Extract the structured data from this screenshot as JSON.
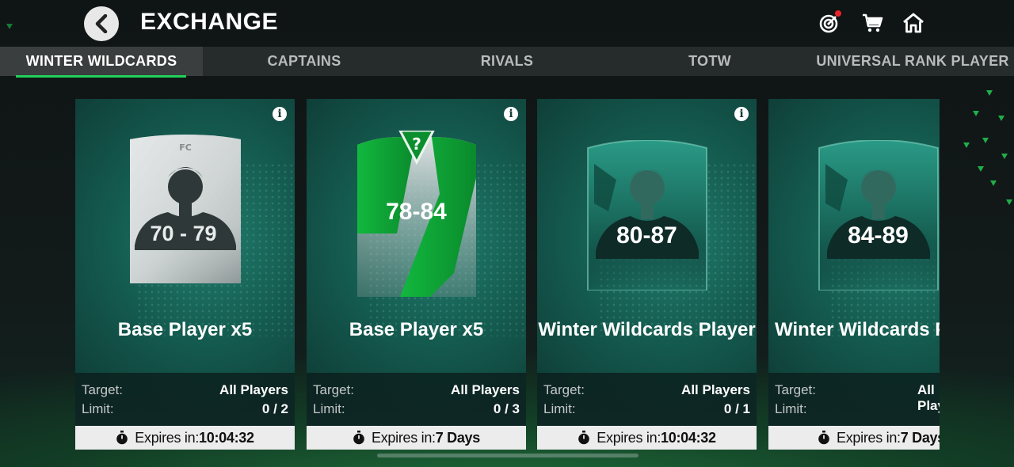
{
  "header": {
    "title": "EXCHANGE",
    "icons": [
      "back-chevron-icon",
      "objectives-target-icon",
      "cart-icon",
      "home-icon"
    ],
    "notification_color": "#e8242b"
  },
  "tabs": [
    {
      "label": "WINTER WILDCARDS",
      "active": true
    },
    {
      "label": "CAPTAINS",
      "active": false
    },
    {
      "label": "RIVALS",
      "active": false
    },
    {
      "label": "TOTW",
      "active": false
    },
    {
      "label": "UNIVERSAL RANK PLAYER",
      "active": false
    }
  ],
  "cards": [
    {
      "title": "Base Player x5",
      "rating": "70 - 79",
      "target_label": "Target:",
      "target": "All Players",
      "limit_label": "Limit:",
      "limit": "0 / 2",
      "expires_label": "Expires in:",
      "expires": "10:04:32"
    },
    {
      "title": "Base Player x5",
      "rating": "78-84",
      "target_label": "Target:",
      "target": "All Players",
      "limit_label": "Limit:",
      "limit": "0 / 3",
      "expires_label": "Expires in:",
      "expires": "7 Days"
    },
    {
      "title": "Winter Wildcards Player",
      "rating": "80-87",
      "target_label": "Target:",
      "target": "All Players",
      "limit_label": "Limit:",
      "limit": "0 / 1",
      "expires_label": "Expires in:",
      "expires": "10:04:32"
    },
    {
      "title": "Winter Wildcards Player",
      "rating": "84-89",
      "target_label": "Target:",
      "target": "All Players",
      "limit_label": "Limit:",
      "limit": "",
      "expires_label": "Expires in:",
      "expires": "7 Days"
    }
  ],
  "colors": {
    "accent": "#1fd15a",
    "card_bg": "#155d51",
    "expire_bar": "#ececec"
  }
}
